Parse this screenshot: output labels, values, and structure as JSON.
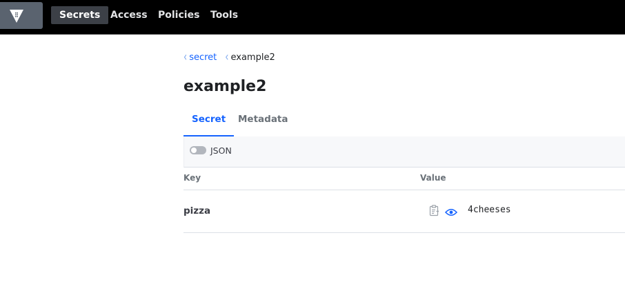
{
  "nav": {
    "items": [
      {
        "label": "Secrets",
        "active": true
      },
      {
        "label": "Access",
        "active": false
      },
      {
        "label": "Policies",
        "active": false
      },
      {
        "label": "Tools",
        "active": false
      }
    ]
  },
  "breadcrumb": {
    "items": [
      {
        "label": "secret",
        "link": true
      },
      {
        "label": "example2",
        "link": false
      }
    ]
  },
  "page": {
    "title": "example2"
  },
  "tabs": [
    {
      "label": "Secret",
      "active": true
    },
    {
      "label": "Metadata",
      "active": false
    }
  ],
  "toolbar": {
    "json_toggle_label": "JSON",
    "json_toggle_on": false
  },
  "table": {
    "columns": [
      "Key",
      "Value"
    ],
    "rows": [
      {
        "key": "pizza",
        "value": "4cheeses"
      }
    ]
  },
  "icons": {
    "logo": "vault-logo-icon",
    "copy": "clipboard-copy-icon",
    "reveal": "eye-icon",
    "crumb_sep": "chevron-left-icon"
  },
  "colors": {
    "nav_bg": "#000000",
    "accent": "#1563ff",
    "logo_bg": "#5a636f"
  }
}
